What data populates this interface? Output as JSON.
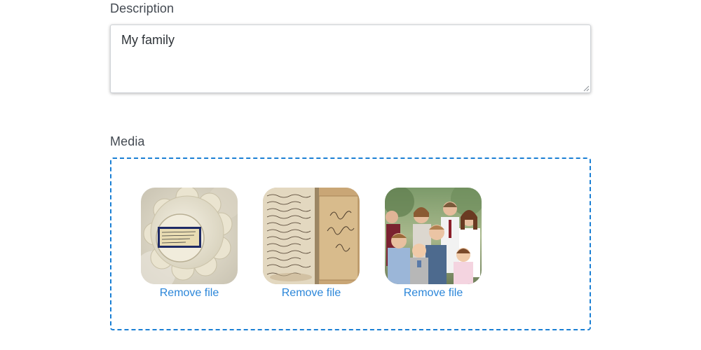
{
  "form": {
    "description": {
      "label": "Description",
      "value": "My family"
    },
    "media": {
      "label": "Media",
      "accent_color": "#1a7fd4",
      "files": [
        {
          "thumbnail": "porcelain-dish-photo",
          "remove_label": "Remove file"
        },
        {
          "thumbnail": "handwritten-book-photo",
          "remove_label": "Remove file"
        },
        {
          "thumbnail": "family-group-photo",
          "remove_label": "Remove file"
        }
      ]
    }
  }
}
